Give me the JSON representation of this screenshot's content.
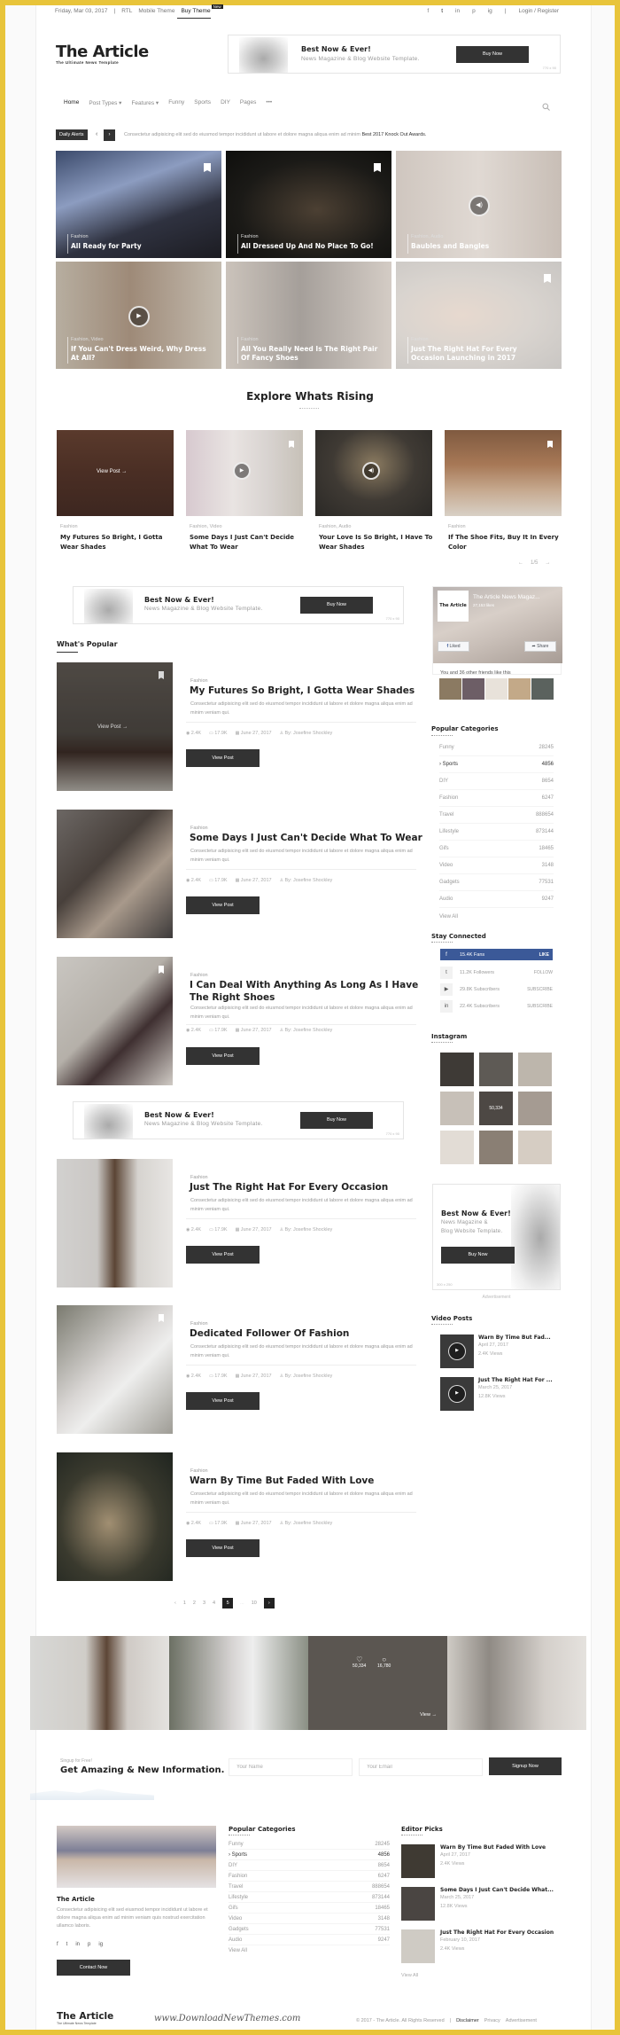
{
  "topbar": {
    "date": "Friday, Mar 03, 2017",
    "sep": "|",
    "rtl": "RTL",
    "mobile": "Mobile Theme",
    "buy": "Buy Theme",
    "new_badge": "New",
    "social": [
      "f",
      "t",
      "in",
      "p",
      "ig"
    ],
    "login": "Login / Register"
  },
  "logo": {
    "name": "The Article",
    "tagline": "The Ultimate News Template"
  },
  "ads": {
    "header": {
      "headline": "Best Now & Ever!",
      "sub": "News Magazine & Blog Website Template.",
      "button": "Buy Now",
      "size": "770 x 90"
    },
    "mid1": {
      "headline": "Best Now & Ever!",
      "sub": "News Magazine & Blog Website Template.",
      "button": "Buy Now",
      "size": "770 x 90"
    },
    "mid2": {
      "headline": "Best Now & Ever!",
      "sub": "News Magazine & Blog Website Template.",
      "button": "Buy Now",
      "size": "770 x 90"
    },
    "side": {
      "headline": "Best Now & Ever!",
      "sub1": "News Magazine &",
      "sub2": "Blog Website Template.",
      "button": "Buy Now",
      "size": "300 x 250",
      "label": "Advertisement"
    }
  },
  "nav": {
    "items": [
      "Home",
      "Post Types ▾",
      "Features ▾",
      "Funny",
      "Sports",
      "DIY",
      "Pages",
      "•••"
    ],
    "search_icon": "search-icon"
  },
  "ticker": {
    "label": "Daily Alerts",
    "prev": "‹",
    "next": "›",
    "text": "Consectetur adipisicing elit sed do eiusmod tempor incididunt ut labore et dolore magna aliqua enim ad minim",
    "highlight": "Best 2017 Knock Out Awards."
  },
  "hero": [
    {
      "cat": "Fashion",
      "title": "All Ready for Party",
      "icon": "bookmark"
    },
    {
      "cat": "Fashion",
      "title": "All Dressed Up And No Place To Go!",
      "icon": "bookmark"
    },
    {
      "cat": "Fashion, Audio",
      "title": "Baubles and Bangles",
      "icon": "audio"
    },
    {
      "cat": "Fashion, Video",
      "title": "If You Can't Dress Weird, Why Dress At All?",
      "icon": "video"
    },
    {
      "cat": "Fashion",
      "title": "All You Really Need Is The Right Pair Of Fancy Shoes",
      "icon": ""
    },
    {
      "cat": "Fashion",
      "title": "Just The Right Hat For Every Occasion Launching in 2017",
      "icon": "bookmark"
    }
  ],
  "rising": {
    "title": "Explore Whats Rising",
    "view_post": "View Post →",
    "pager": "1/5",
    "items": [
      {
        "cat": "Fashion",
        "title": "My Futures So Bright, I Gotta Wear Shades"
      },
      {
        "cat": "Fashion, Video",
        "title": "Some Days I Just Can't Decide What To Wear"
      },
      {
        "cat": "Fashion, Audio",
        "title": "Your Love Is So Bright, I Have To Wear Shades"
      },
      {
        "cat": "Fashion",
        "title": "If The Shoe Fits, Buy It In Every Color"
      }
    ]
  },
  "popular": {
    "title": "What's Popular",
    "view_post": "View Post",
    "overlay": "View Post →",
    "excerpt": "Consectetur adipisicing elit sed do eiusmod tempor incididunt ut labore et dolore magna aliqua enim ad minim veniam qui.",
    "items": [
      {
        "cat": "Fashion",
        "title": "My Futures So Bright, I Gotta Wear Shades",
        "views": "2.4K",
        "comments": "17.9K",
        "date": "June 27, 2017",
        "author": "By: Josefine Shockley"
      },
      {
        "cat": "Fashion",
        "title": "Some Days I Just Can't Decide What To Wear",
        "views": "2.4K",
        "comments": "17.9K",
        "date": "June 27, 2017",
        "author": "By: Josefine Shockley"
      },
      {
        "cat": "Fashion",
        "title": "I Can Deal With Anything As Long As I Have The Right Shoes",
        "views": "2.4K",
        "comments": "17.9K",
        "date": "June 27, 2017",
        "author": "By: Josefine Shockley"
      },
      {
        "cat": "Fashion",
        "title": "Just The Right Hat For Every Occasion",
        "views": "2.4K",
        "comments": "17.9K",
        "date": "June 27, 2017",
        "author": "By: Josefine Shockley"
      },
      {
        "cat": "Fashion",
        "title": "Dedicated Follower Of Fashion",
        "views": "2.4K",
        "comments": "17.9K",
        "date": "June 27, 2017",
        "author": "By: Josefine Shockley"
      },
      {
        "cat": "Fashion",
        "title": "Warn By Time But Faded With Love",
        "views": "2.4K",
        "comments": "17.9K",
        "date": "June 27, 2017",
        "author": "By: Josefine Shockley"
      }
    ]
  },
  "pagination": {
    "prev": "‹",
    "pages": [
      "1",
      "2",
      "3",
      "4",
      "5",
      "...",
      "10"
    ],
    "current": "5",
    "next": "›"
  },
  "sidebar": {
    "fb": {
      "page_name": "The Article News Magaz...",
      "likes": "27,153 likes",
      "logo": "The Article",
      "liked": "Liked",
      "share": "Share",
      "friends": "You and 36 other friends like this"
    },
    "categories_title": "Popular Categories",
    "categories": [
      {
        "name": "Funny",
        "count": "28245"
      },
      {
        "name": "› Sports",
        "count": "4856",
        "active": true
      },
      {
        "name": "DIY",
        "count": "8654"
      },
      {
        "name": "Fashion",
        "count": "6247"
      },
      {
        "name": "Travel",
        "count": "888654"
      },
      {
        "name": "Lifestyle",
        "count": "873144"
      },
      {
        "name": "Gifs",
        "count": "18465"
      },
      {
        "name": "Video",
        "count": "3148"
      },
      {
        "name": "Gadgets",
        "count": "77531"
      },
      {
        "name": "Audio",
        "count": "9247"
      }
    ],
    "view_all": "View All",
    "connected_title": "Stay Connected",
    "social": [
      {
        "icon": "f",
        "label": "15.4K Fans",
        "action": "LIKE"
      },
      {
        "icon": "t",
        "label": "11.2K Followers",
        "action": "FOLLOW"
      },
      {
        "icon": "▶",
        "label": "29.8K Subscribers",
        "action": "SUBSCRIBE"
      },
      {
        "icon": "in",
        "label": "22.4K Subscribers",
        "action": "SUBSCRIBE"
      }
    ],
    "instagram_title": "Instagram",
    "instagram_overlay": "50,334",
    "video_title": "Video Posts",
    "videos": [
      {
        "title": "Warn By Time But Fad...",
        "date": "April 27, 2017",
        "views": "2.4K Views"
      },
      {
        "title": "Just The Right Hat For ...",
        "date": "March 25, 2017",
        "views": "12.8K Views"
      }
    ]
  },
  "gallery": {
    "likes": "50,334",
    "comments": "16,780",
    "view": "View →"
  },
  "signup": {
    "kicker": "Singup for Free!",
    "title": "Get Amazing & New Information.",
    "name_placeholder": "Your Name",
    "email_placeholder": "Your Email",
    "button": "Signup Now"
  },
  "footer": {
    "about_title": "The Article",
    "about_text": "Consectetur adipisicing elit sed eiusmod tempor incididunt ut labore et dolore magna aliqua enim ad minim veniam quis nostrud exercitation ullamco laboris.",
    "social": [
      "f",
      "t",
      "in",
      "p",
      "ig"
    ],
    "contact": "Contact Now",
    "categories_title": "Popular Categories",
    "categories": [
      {
        "name": "Funny",
        "count": "28245"
      },
      {
        "name": "› Sports",
        "count": "4856",
        "active": true
      },
      {
        "name": "DIY",
        "count": "8654"
      },
      {
        "name": "Fashion",
        "count": "6247"
      },
      {
        "name": "Travel",
        "count": "888654"
      },
      {
        "name": "Lifestyle",
        "count": "873144"
      },
      {
        "name": "Gifs",
        "count": "18465"
      },
      {
        "name": "Video",
        "count": "3148"
      },
      {
        "name": "Gadgets",
        "count": "77531"
      },
      {
        "name": "Audio",
        "count": "9247"
      }
    ],
    "view_all": "View All",
    "editor_title": "Editor Picks",
    "editor": [
      {
        "title": "Warn By Time But Faded With Love",
        "date": "April 27, 2017",
        "views": "2.4K Views"
      },
      {
        "title": "Some Days I Just Can't Decide What...",
        "date": "March 25, 2017",
        "views": "12.8K Views"
      },
      {
        "title": "Just The Right Hat For Every Occasion",
        "date": "February 10, 2017",
        "views": "2.4K Views"
      }
    ],
    "editor_view_all": "View All",
    "bottom": {
      "logo": "The Article",
      "tagline": "The Ultimate News Template",
      "watermark": "www.DownloadNewThemes.com",
      "copyright": "© 2017 - The Article. All Rights Reserved",
      "sep": "|",
      "links": [
        "Disclaimer",
        "Privacy",
        "Advertisement"
      ]
    }
  },
  "colors": {
    "frame": "#e8c43a",
    "dark": "#333333",
    "fb_blue": "#3b5998"
  }
}
